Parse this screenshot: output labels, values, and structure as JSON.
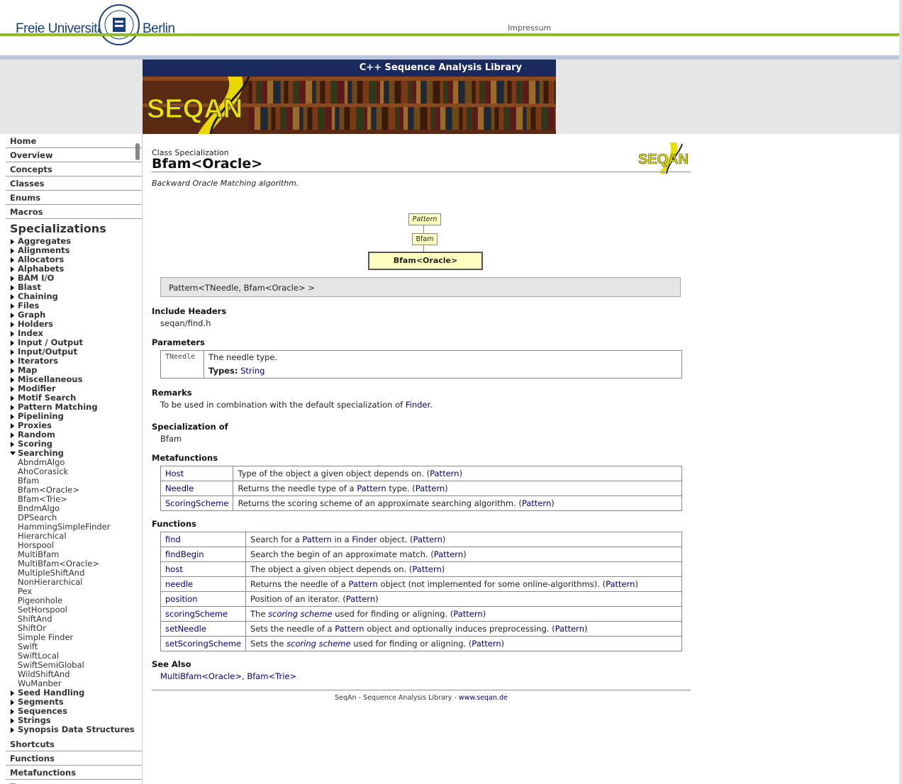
{
  "header": {
    "logo_left": "Freie Universität",
    "logo_right": "Berlin",
    "impressum": "Impressum"
  },
  "banner": {
    "title": "C++ Sequence Analysis Library",
    "logo_text": "SEQAN"
  },
  "sidebar": {
    "top_items": [
      "Home",
      "Overview",
      "Concepts",
      "Classes",
      "Enums",
      "Macros"
    ],
    "specializations_heading": "Specializations",
    "categories_before": [
      "Aggregates",
      "Alignments",
      "Allocators",
      "Alphabets",
      "BAM I/O",
      "Blast",
      "Chaining",
      "Files",
      "Graph",
      "Holders",
      "Index",
      "Input / Output",
      "Input/Output",
      "Iterators",
      "Map",
      "Miscellaneous",
      "Modifier",
      "Motif Search",
      "Pattern Matching",
      "Pipelining",
      "Proxies",
      "Random",
      "Scoring"
    ],
    "open_category": "Searching",
    "searching_items": [
      "AbndmAlgo",
      "AhoCorasick",
      "Bfam",
      "Bfam<Oracle>",
      "Bfam<Trie>",
      "BndmAlgo",
      "DPSearch",
      "HammingSimpleFinder",
      "Hierarchical",
      "Horspool",
      "MultiBfam",
      "MultiBfam<Oracle>",
      "MultipleShiftAnd",
      "NonHierarchical",
      "Pex",
      "Pigeonhole",
      "SetHorspool",
      "ShiftAnd",
      "ShiftOr",
      "Simple Finder",
      "Swift",
      "SwiftLocal",
      "SwiftSemiGlobal",
      "WildShiftAnd",
      "WuManber"
    ],
    "categories_after": [
      "Seed Handling",
      "Segments",
      "Sequences",
      "Strings",
      "Synopsis Data Structures"
    ],
    "bottom_items": [
      "Shortcuts",
      "Functions",
      "Metafunctions",
      "Tags"
    ]
  },
  "page": {
    "kind": "Class Specialization",
    "title": "Bfam<Oracle>",
    "summary": "Backward Oracle Matching algorithm.",
    "hierarchy": [
      "Pattern",
      "Bfam",
      "Bfam<Oracle>"
    ],
    "signature": "Pattern<TNeedle, Bfam<Oracle> >",
    "include_headers_label": "Include Headers",
    "include_header": "seqan/find.h",
    "parameters_label": "Parameters",
    "param_name": "TNeedle",
    "param_desc": "The needle type.",
    "param_types_label": "Types:",
    "param_types_value": "String",
    "remarks_label": "Remarks",
    "remarks_text": "To be used in combination with the default specialization of",
    "remarks_link": "Finder",
    "remarks_end": ".",
    "specialization_of_label": "Specialization of",
    "specialization_of": "Bfam",
    "metafunctions_label": "Metafunctions",
    "functions_label": "Functions",
    "see_also_label": "See Also",
    "see_also_1": "MultiBfam<Oracle>",
    "see_also_sep": ",",
    "see_also_2": "Bfam<Trie>",
    "footer_text": "SeqAn - Sequence Analysis Library -",
    "footer_link": "www.seqan.de"
  },
  "metafunctions": [
    {
      "name": "Host",
      "parts": [
        {
          "t": "Type of the object a given object depends on. (",
          "l": false
        },
        {
          "t": "Pattern",
          "l": true
        },
        {
          "t": ")",
          "l": false
        }
      ]
    },
    {
      "name": "Needle",
      "parts": [
        {
          "t": "Returns the needle type of a ",
          "l": false
        },
        {
          "t": "Pattern",
          "l": true
        },
        {
          "t": " type. (",
          "l": false
        },
        {
          "t": "Pattern",
          "l": true
        },
        {
          "t": ")",
          "l": false
        }
      ]
    },
    {
      "name": "ScoringScheme",
      "parts": [
        {
          "t": "Returns the scoring scheme of an approximate searching algorithm. (",
          "l": false
        },
        {
          "t": "Pattern",
          "l": true
        },
        {
          "t": ")",
          "l": false
        }
      ]
    }
  ],
  "functions": [
    {
      "name": "find",
      "parts": [
        {
          "t": "Search for a ",
          "l": false
        },
        {
          "t": "Pattern",
          "l": true
        },
        {
          "t": " in a ",
          "l": false
        },
        {
          "t": "Finder",
          "l": true
        },
        {
          "t": " object. (",
          "l": false
        },
        {
          "t": "Pattern",
          "l": true
        },
        {
          "t": ")",
          "l": false
        }
      ]
    },
    {
      "name": "findBegin",
      "parts": [
        {
          "t": "Search the begin of an approximate match. (",
          "l": false
        },
        {
          "t": "Pattern",
          "l": true
        },
        {
          "t": ")",
          "l": false
        }
      ]
    },
    {
      "name": "host",
      "parts": [
        {
          "t": "The object a given object depends on. (",
          "l": false
        },
        {
          "t": "Pattern",
          "l": true
        },
        {
          "t": ")",
          "l": false
        }
      ]
    },
    {
      "name": "needle",
      "parts": [
        {
          "t": "Returns the needle of a ",
          "l": false
        },
        {
          "t": "Pattern",
          "l": true
        },
        {
          "t": " object (not implemented for some online-algorithms). (",
          "l": false
        },
        {
          "t": "Pattern",
          "l": true
        },
        {
          "t": ")",
          "l": false
        }
      ]
    },
    {
      "name": "position",
      "parts": [
        {
          "t": "Position of an iterator. (",
          "l": false
        },
        {
          "t": "Pattern",
          "l": true
        },
        {
          "t": ")",
          "l": false
        }
      ]
    },
    {
      "name": "scoringScheme",
      "parts": [
        {
          "t": "The ",
          "l": false
        },
        {
          "t": "scoring scheme",
          "l": true,
          "i": true
        },
        {
          "t": " used for finding or aligning. (",
          "l": false
        },
        {
          "t": "Pattern",
          "l": true
        },
        {
          "t": ")",
          "l": false
        }
      ]
    },
    {
      "name": "setNeedle",
      "parts": [
        {
          "t": "Sets the needle of a ",
          "l": false
        },
        {
          "t": "Pattern",
          "l": true
        },
        {
          "t": " object and optionally induces preprocessing. (",
          "l": false
        },
        {
          "t": "Pattern",
          "l": true
        },
        {
          "t": ")",
          "l": false
        }
      ]
    },
    {
      "name": "setScoringScheme",
      "parts": [
        {
          "t": "Sets the ",
          "l": false
        },
        {
          "t": "scoring scheme",
          "l": true,
          "i": true
        },
        {
          "t": " used for finding or aligning. (",
          "l": false
        },
        {
          "t": "Pattern",
          "l": true
        },
        {
          "t": ")",
          "l": false
        }
      ]
    }
  ]
}
